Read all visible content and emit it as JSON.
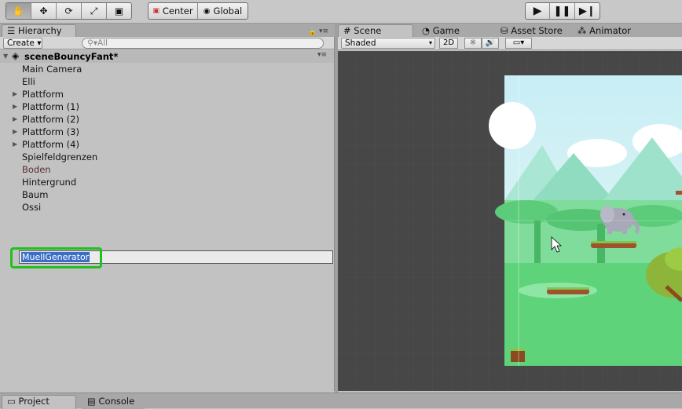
{
  "toolbar": {
    "pivot_label": "Center",
    "space_label": "Global",
    "tools": [
      "hand-icon",
      "move-icon",
      "rotate-icon",
      "scale-icon",
      "rect-icon"
    ],
    "play": [
      "play-icon",
      "pause-icon",
      "step-icon"
    ]
  },
  "hierarchy": {
    "tab_label": "Hierarchy",
    "create_label": "Create ▾",
    "search_placeholder": "All",
    "scene_name": "sceneBouncyFant*",
    "rename_value": "MuellGenerator",
    "items": [
      {
        "label": "Main Camera",
        "expandable": false,
        "style": "normal"
      },
      {
        "label": "Elli",
        "expandable": false,
        "style": "normal"
      },
      {
        "label": "Plattform",
        "expandable": true,
        "style": "normal"
      },
      {
        "label": "Plattform (1)",
        "expandable": true,
        "style": "normal"
      },
      {
        "label": "Plattform (2)",
        "expandable": true,
        "style": "normal"
      },
      {
        "label": "Plattform (3)",
        "expandable": true,
        "style": "normal"
      },
      {
        "label": "Plattform (4)",
        "expandable": true,
        "style": "normal"
      },
      {
        "label": "Spielfeldgrenzen",
        "expandable": false,
        "style": "normal"
      },
      {
        "label": "Boden",
        "expandable": false,
        "style": "brown"
      },
      {
        "label": "Hintergrund",
        "expandable": false,
        "style": "normal"
      },
      {
        "label": "Baum",
        "expandable": false,
        "style": "normal"
      },
      {
        "label": "Ossi",
        "expandable": false,
        "style": "normal"
      }
    ]
  },
  "scene": {
    "tabs": [
      {
        "label": "Scene",
        "icon": "grid-icon",
        "active": true
      },
      {
        "label": "Game",
        "icon": "pacman-icon",
        "active": false
      },
      {
        "label": "Asset Store",
        "icon": "store-icon",
        "active": false
      },
      {
        "label": "Animator",
        "icon": "animator-icon",
        "active": false
      }
    ],
    "shading_mode": "Shaded",
    "mode_2d": "2D"
  },
  "bottom": {
    "tabs": [
      {
        "label": "Project",
        "icon": "folder-icon"
      },
      {
        "label": "Console",
        "icon": "console-icon"
      }
    ]
  },
  "colors": {
    "selection": "#3b6ec7",
    "highlight_box": "#20c020",
    "sky": "#cfeff7",
    "ground": "#5fd37a"
  }
}
